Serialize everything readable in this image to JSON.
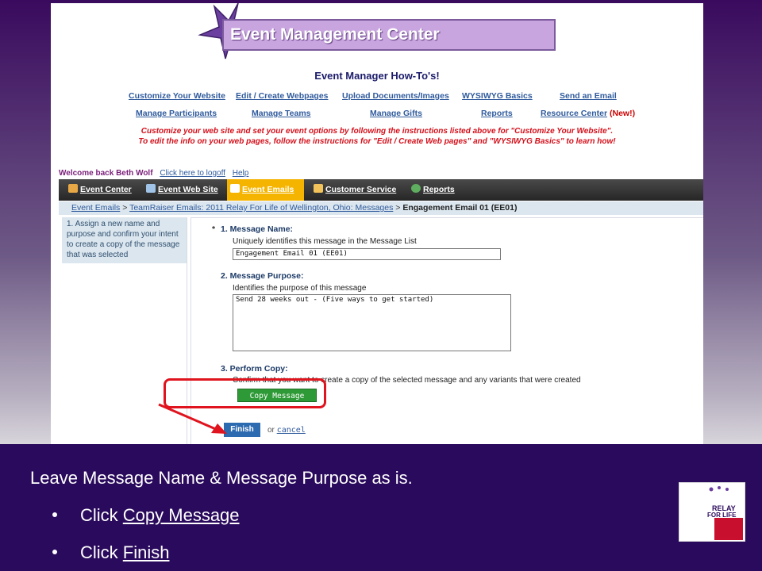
{
  "header": {
    "banner_title": "Event Management Center",
    "howto_title": "Event Manager How-To's!"
  },
  "howto_links_row1": [
    "Customize Your Website",
    "Edit / Create Webpages",
    "Upload Documents/Images",
    "WYSIWYG Basics",
    "Send an Email"
  ],
  "howto_links_row2": [
    "Manage Participants",
    "Manage Teams",
    "Manage Gifts",
    "Reports",
    "Resource Center"
  ],
  "new_badge": "(New!)",
  "instructions": [
    "Customize your web site and set your event options by following the instructions listed above for \"Customize Your Website\".",
    "To edit the info on your web pages, follow the instructions for \"Edit / Create Web pages\" and \"WYSIWYG Basics\" to learn how!"
  ],
  "welcome": {
    "text": "Welcome back Beth Wolf",
    "logoff": "Click here to logoff",
    "help": "Help"
  },
  "nav_tabs": [
    {
      "label": "Event Center",
      "icon": "house-icon",
      "active": false
    },
    {
      "label": "Event Web Site",
      "icon": "webpage-icon",
      "active": false
    },
    {
      "label": "Event Emails",
      "icon": "envelope-icon",
      "active": true
    },
    {
      "label": "Customer Service",
      "icon": "people-icon",
      "active": false
    },
    {
      "label": "Reports",
      "icon": "globe-icon",
      "active": false
    }
  ],
  "breadcrumb": {
    "item1": "Event Emails",
    "item2": "TeamRaiser Emails: 2011 Relay For Life of Wellington, Ohio: Messages",
    "current": "Engagement Email 01 (EE01)",
    "sep": ">"
  },
  "sidebar": {
    "step_text": "1.   Assign a new name and purpose and confirm your intent to create a copy of the message that was selected"
  },
  "form": {
    "required_mark": "*",
    "step1_title": "1.   Message Name:",
    "step1_desc": "Uniquely identifies this message in the Message List",
    "name_value": "Engagement Email 01 (EE01)",
    "step2_title": "2.   Message Purpose:",
    "step2_desc": "Identifies the purpose of this message",
    "purpose_value": "Send 28 weeks out - (Five ways to get started)",
    "step3_title": "3.   Perform Copy:",
    "step3_desc": "Confirm that you want to create a copy of the selected message and any variants that were created",
    "copy_button": "Copy Message",
    "finish_button": "Finish",
    "or_text": "or",
    "cancel_link": "cancel"
  },
  "panel": {
    "main_text": "Leave Message Name & Message Purpose as is.",
    "bullet1_prefix": "Click ",
    "bullet1_link": "Copy Message",
    "bullet2_prefix": "Click ",
    "bullet2_link": "Finish"
  },
  "logo": {
    "line1": "RELAY",
    "line2": "FOR LIFE",
    "org": "American Cancer Society"
  },
  "colors": {
    "panel_bg": "#2a0a5c",
    "highlight_red": "#e0141e",
    "active_tab": "#f5b400",
    "copy_button": "#2e9a37",
    "finish_button": "#2d6bb0"
  }
}
